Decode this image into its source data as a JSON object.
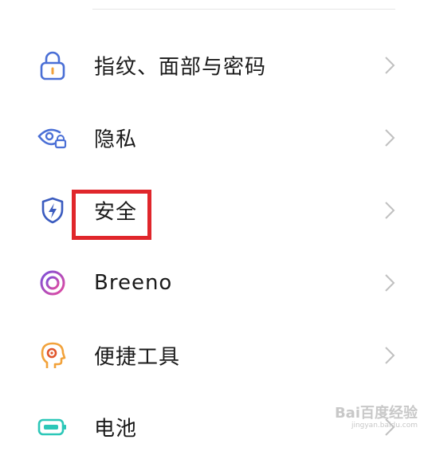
{
  "colors": {
    "highlight_border": "#e0262b",
    "chevron": "#c0c0c0",
    "icon_blue": "#4a6fd6",
    "icon_pink": "#d44bb4",
    "icon_orange": "#f2a23a",
    "icon_teal": "#2cc7b8"
  },
  "settings": {
    "items": [
      {
        "label": "指纹、面部与密码",
        "icon": "lock-icon"
      },
      {
        "label": "隐私",
        "icon": "eye-lock-icon"
      },
      {
        "label": "安全",
        "icon": "shield-bolt-icon",
        "highlighted": true
      },
      {
        "label": "Breeno",
        "icon": "breeno-ring-icon"
      },
      {
        "label": "便捷工具",
        "icon": "head-gear-icon"
      },
      {
        "label": "电池",
        "icon": "battery-icon"
      }
    ]
  },
  "watermark": {
    "main": "Bai百度经验",
    "sub": "jingyan.baidu.com"
  }
}
